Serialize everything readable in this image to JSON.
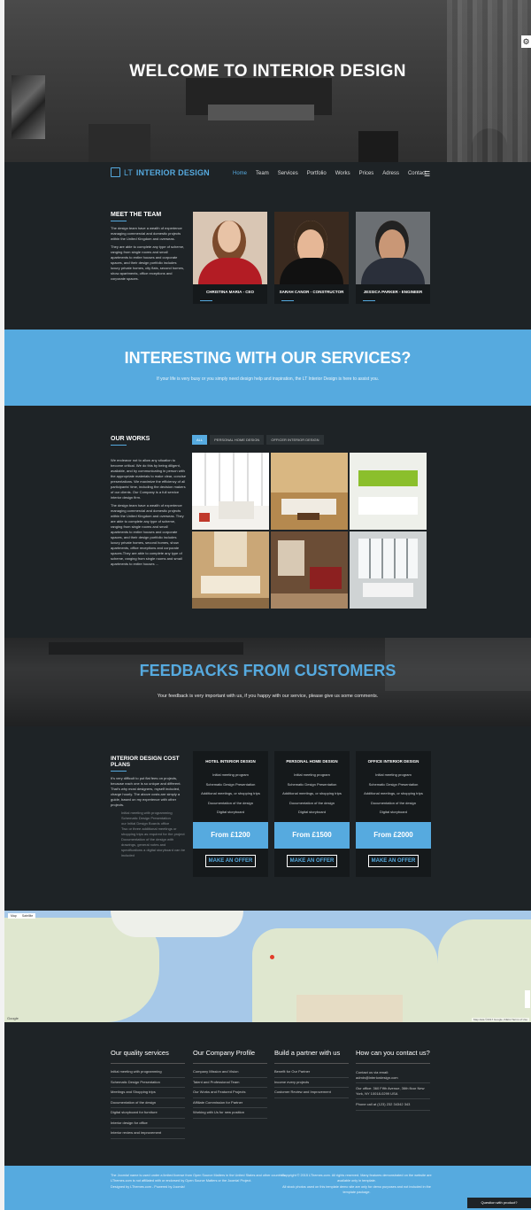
{
  "hero": {
    "title": "WELCOME TO INTERIOR DESIGN",
    "settings_icon": "gear-icon"
  },
  "nav": {
    "logo_prefix": "LT",
    "logo_name": "INTERIOR DESIGN",
    "items": [
      "Home",
      "Team",
      "Services",
      "Portfolio",
      "Works",
      "Prices",
      "Adress",
      "Contact"
    ],
    "active": "Home",
    "menu_icon": "hamburger-icon"
  },
  "team": {
    "title": "MEET THE TEAM",
    "p1": "The design team have a wealth of experience managing commercial and domestic projects within the United Kingdom and overseas.",
    "p2": "They are able to complete any type of scheme, ranging from single rooms and small apartments to entire houses and corporate spaces, and their design portfolio includes luxury private homes, city flats, second homes, show apartments, office receptions and corporate spaces.",
    "members": [
      {
        "name": "CHRISTINA MARIA - CEO"
      },
      {
        "name": "SARAH CANOR - CONSTRUCTOR"
      },
      {
        "name": "JESSICA PARKER - ENGINEER"
      }
    ]
  },
  "services": {
    "title": "INTERESTING WITH OUR SERVICES?",
    "subtitle": "If your life is very busy or you simply need design help and inspiration, the LT Interior Design is here to assist you."
  },
  "works": {
    "title": "OUR WORKS",
    "p1": "We endeavor not to allow any situation to become critical. We do this by being diligent, available, and by communicating in person with the appropriate materials to make clear, concise presentations. We maximize the efficiency of all participants' time, including the decision makers of our clients. Our Company is a full service interior design firm.",
    "p2": "The design team have a wealth of experience managing commercial and domestic projects within the United Kingdom and overseas. They are able to complete any type of scheme, ranging from single rooms and small apartments to entire houses and corporate spaces, and their design portfolio includes luxury private homes, second homes, show apartments, office receptions and corporate spaces.They are able to complete any type of scheme, ranging from single rooms and small apartments to entire houses ...",
    "filters": [
      "ALL",
      "PERSONAL HOME DESIGN",
      "OFFICER INTERIOR DESIGN"
    ]
  },
  "feedback": {
    "title": "FEEDBACKS FROM CUSTOMERS",
    "subtitle": "Your feedback is very important with us, if you happy with our service, please give us some comments."
  },
  "pricing": {
    "title": "INTERIOR DESIGN COST PLANS",
    "p1": "It's very difficult to put flat fees on projects, because each one is so unique and different. That's why most designers, myself included, charge hourly. The above costs are simply a guide, based on my experience with other projects.",
    "notes": [
      "Initial meeting with programming",
      "Schematic Design Presentation",
      "our Initial Design Boards office",
      "Two or three additional meetings or shopping trips as required for the project",
      "Documentation of the design with drawings, general notes and specifications a digital storyboard can be included"
    ],
    "features": [
      "Initial meeting program",
      "Schematic Design Presentation",
      "Additional meetings, or shopping trips",
      "Documentation of the design",
      "Digital storyboard"
    ],
    "plans": [
      {
        "name": "HOTEL INTERIOR DESIGN",
        "price": "From £1200",
        "cta": "MAKE AN OFFER"
      },
      {
        "name": "PERSONAL HOME DESIGN",
        "price": "From £1500",
        "cta": "MAKE AN OFFER"
      },
      {
        "name": "OFFICE INTERIOR DESIGN",
        "price": "From £2000",
        "cta": "MAKE AN OFFER"
      }
    ]
  },
  "map": {
    "btn_map": "Map",
    "btn_sat": "Satellite",
    "google": "Google",
    "attr": "Map data ©2017 Google, INEGI Terms of Use"
  },
  "footer": {
    "col1": {
      "title": "Our quality services",
      "items": [
        "Initial meeting with programming",
        "Schematic Design Presentation",
        "Meetings and Shopping trips",
        "Documentation of the design",
        "Digital storyboard for furniture",
        "Interior design for office",
        "Interior review and improvement"
      ]
    },
    "col2": {
      "title": "Our Company Profile",
      "items": [
        "Company Mission and Vision",
        "Talent and Professional Team",
        "Our Works and Featured Projects",
        "Affiliate Commission for Partner",
        "Working with Us for new position"
      ]
    },
    "col3": {
      "title": "Build a partner with us",
      "items": [
        "Benefit for Our Partner",
        "Income every projects",
        "Customer Review and Improvement"
      ]
    },
    "col4": {
      "title": "How can you contact us?",
      "items": [
        "Contact us via email: admin@interiordesign.com",
        "Our office: 360 Fifth Avenue, 36th floor New York, NY 10018-0299 USA",
        "Phone call at (123) 232 34342 343"
      ]
    }
  },
  "bottom": {
    "left": "The Joomla! name is used under a limited license from Open Source Matters in the United States and other countries. LThemes.com is not affiliated with or endorsed by Open Source Matters or the Joomla! Project.",
    "left2": "Designed by LThemes.com - Powered by Joomla!",
    "right": "Copyright © 2015 LThemes.com. All rights reserved. Many features demonstrated on the website are available only in template.",
    "right2": "All stock photos used on this template demo site are only for demo purposes and not included in the template package.",
    "question": "Question with product?"
  }
}
